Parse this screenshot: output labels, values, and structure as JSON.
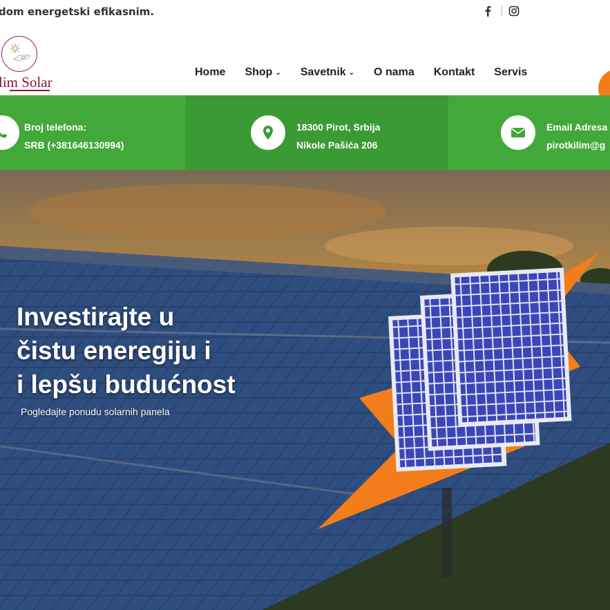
{
  "topbar": {
    "tagline": "dom energetski efikasnim.",
    "social": [
      "facebook-icon",
      "instagram-icon"
    ]
  },
  "header": {
    "logo_text": "lim Solar",
    "nav": [
      {
        "label": "Home",
        "dropdown": false
      },
      {
        "label": "Shop",
        "dropdown": true
      },
      {
        "label": "Savetnik",
        "dropdown": true
      },
      {
        "label": "O nama",
        "dropdown": false
      },
      {
        "label": "Kontakt",
        "dropdown": false
      },
      {
        "label": "Servis",
        "dropdown": false
      }
    ]
  },
  "info": {
    "phone_label": "Broj telefona:",
    "phone_value": "SRB (+381646130994)",
    "address_line1": "18300 Pirot, Srbija",
    "address_line2": "Nikole Pašića 206",
    "email_label": "Email Adresa",
    "email_value": "pirotkilim@g"
  },
  "hero": {
    "title_line1": "Investirajte u",
    "title_line2": "čistu eneregiju i",
    "title_line3": "i lepšu budućnost",
    "subtitle": "Pogledajte ponudu solarnih panela"
  },
  "colors": {
    "green": "#43a83a",
    "green_dark": "#3a9a34",
    "orange": "#f27d1a",
    "logo": "#8a1538"
  }
}
